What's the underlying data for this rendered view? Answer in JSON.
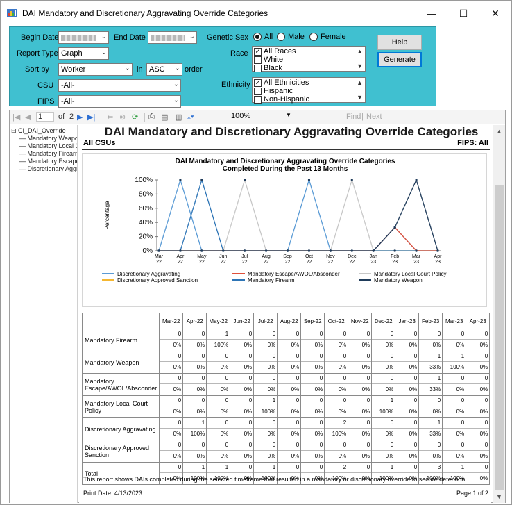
{
  "window": {
    "title": "DAI Mandatory and Discretionary Aggravating Override Categories",
    "minimize_glyph": "—",
    "maximize_glyph": "☐",
    "close_glyph": "✕"
  },
  "filters": {
    "begin_date_label": "Begin Date",
    "end_date_label": "End Date",
    "report_type_label": "Report Type",
    "report_type_value": "Graph",
    "sort_by_label": "Sort by",
    "sort_by_value": "Worker",
    "in_label": "in",
    "order_value": "ASC",
    "order_label": "order",
    "csu_label": "CSU",
    "csu_value": "-All-",
    "fips_label": "FIPS",
    "fips_value": "-All-",
    "genetic_sex_label": "Genetic Sex",
    "sex_options": [
      {
        "label": "All",
        "selected": true
      },
      {
        "label": "Male",
        "selected": false
      },
      {
        "label": "Female",
        "selected": false
      }
    ],
    "race_label": "Race",
    "race_items": [
      {
        "label": "All Races",
        "checked": true
      },
      {
        "label": "White",
        "checked": false
      },
      {
        "label": "Black",
        "checked": false
      }
    ],
    "ethnicity_label": "Ethnicity",
    "ethnicity_items": [
      {
        "label": "All Ethnicities",
        "checked": true
      },
      {
        "label": "Hispanic",
        "checked": false
      },
      {
        "label": "Non-Hispanic",
        "checked": false
      }
    ],
    "help_label": "Help",
    "generate_label": "Generate",
    "panel_color": "#40c0d0"
  },
  "toolbar": {
    "current_page": "1",
    "of_label": "of",
    "total_pages": "2",
    "zoom": "100%",
    "find_label": "Find",
    "next_label": "Next",
    "separator": "|"
  },
  "doc_map": {
    "root": "CI_DAI_Override",
    "items": [
      "Mandatory Weapon",
      "Mandatory Local Court Policy",
      "Mandatory Firearm",
      "Mandatory Escape/AWOL/Absconder",
      "Discretionary Aggravating"
    ]
  },
  "report": {
    "title": "DAI Mandatory and Discretionary Aggravating Override Categories",
    "csu": "All CSUs",
    "fips": "FIPS: All",
    "footnote": "This report shows DAIs completed during the selected timeframe that resulted in a mandatory or discretionary override to secure detention.",
    "print_date": "Print Date: 4/13/2023",
    "page": "Page 1 of 2"
  },
  "chart_data": {
    "type": "line",
    "title": "DAI Mandatory and Discretionary Aggravating Override Categories",
    "subtitle": "Completed During the Past 13 Months",
    "ylabel": "Percentage",
    "xlabel": "",
    "ylim": [
      0,
      100
    ],
    "yticks": [
      "0%",
      "20%",
      "40%",
      "60%",
      "80%",
      "100%"
    ],
    "categories": [
      "Mar 22",
      "Apr 22",
      "May 22",
      "Jun 22",
      "Jul 22",
      "Aug 22",
      "Sep 22",
      "Oct 22",
      "Nov 22",
      "Dec 22",
      "Jan 23",
      "Feb 23",
      "Mar 23",
      "Apr 23"
    ],
    "legend_position": "bottom",
    "grid": false,
    "series": [
      {
        "name": "Discretionary Aggravating",
        "color": "#5b9bd5",
        "values": [
          0,
          100,
          0,
          0,
          0,
          0,
          0,
          100,
          0,
          0,
          0,
          33,
          0,
          0
        ]
      },
      {
        "name": "Mandatory Escape/AWOL/Absconder",
        "color": "#e0503a",
        "values": [
          0,
          0,
          0,
          0,
          0,
          0,
          0,
          0,
          0,
          0,
          0,
          33,
          0,
          0
        ]
      },
      {
        "name": "Mandatory Local Court Policy",
        "color": "#c8c8c8",
        "values": [
          0,
          0,
          0,
          0,
          100,
          0,
          0,
          0,
          0,
          100,
          0,
          0,
          0,
          0
        ]
      },
      {
        "name": "Discretionary Approved Sanction",
        "color": "#f5b731",
        "values": [
          0,
          0,
          0,
          0,
          0,
          0,
          0,
          0,
          0,
          0,
          0,
          0,
          0,
          0
        ]
      },
      {
        "name": "Mandatory Firearm",
        "color": "#2e75b6",
        "values": [
          0,
          0,
          100,
          0,
          0,
          0,
          0,
          0,
          0,
          0,
          0,
          0,
          0,
          0
        ]
      },
      {
        "name": "Mandatory Weapon",
        "color": "#1f3b5a",
        "values": [
          0,
          0,
          0,
          0,
          0,
          0,
          0,
          0,
          0,
          0,
          0,
          33,
          100,
          0
        ]
      }
    ]
  },
  "table": {
    "columns": [
      "Mar-22",
      "Apr-22",
      "May-22",
      "Jun-22",
      "Jul-22",
      "Aug-22",
      "Sep-22",
      "Oct-22",
      "Nov-22",
      "Dec-22",
      "Jan-23",
      "Feb-23",
      "Mar-23",
      "Apr-23"
    ],
    "rows": [
      {
        "label": "Mandatory Firearm",
        "counts": [
          "0",
          "0",
          "1",
          "0",
          "0",
          "0",
          "0",
          "0",
          "0",
          "0",
          "0",
          "0",
          "0",
          "0"
        ],
        "pcts": [
          "0%",
          "0%",
          "100%",
          "0%",
          "0%",
          "0%",
          "0%",
          "0%",
          "0%",
          "0%",
          "0%",
          "0%",
          "0%",
          "0%"
        ]
      },
      {
        "label": "Mandatory Weapon",
        "counts": [
          "0",
          "0",
          "0",
          "0",
          "0",
          "0",
          "0",
          "0",
          "0",
          "0",
          "0",
          "1",
          "1",
          "0"
        ],
        "pcts": [
          "0%",
          "0%",
          "0%",
          "0%",
          "0%",
          "0%",
          "0%",
          "0%",
          "0%",
          "0%",
          "0%",
          "33%",
          "100%",
          "0%"
        ]
      },
      {
        "label": "Mandatory Escape/AWOL/Absconder",
        "counts": [
          "0",
          "0",
          "0",
          "0",
          "0",
          "0",
          "0",
          "0",
          "0",
          "0",
          "0",
          "1",
          "0",
          "0"
        ],
        "pcts": [
          "0%",
          "0%",
          "0%",
          "0%",
          "0%",
          "0%",
          "0%",
          "0%",
          "0%",
          "0%",
          "0%",
          "33%",
          "0%",
          "0%"
        ]
      },
      {
        "label": "Mandatory Local Court Policy",
        "counts": [
          "0",
          "0",
          "0",
          "0",
          "1",
          "0",
          "0",
          "0",
          "0",
          "1",
          "0",
          "0",
          "0",
          "0"
        ],
        "pcts": [
          "0%",
          "0%",
          "0%",
          "0%",
          "100%",
          "0%",
          "0%",
          "0%",
          "0%",
          "100%",
          "0%",
          "0%",
          "0%",
          "0%"
        ]
      },
      {
        "label": "Discretionary Aggravating",
        "counts": [
          "0",
          "1",
          "0",
          "0",
          "0",
          "0",
          "0",
          "2",
          "0",
          "0",
          "0",
          "1",
          "0",
          "0"
        ],
        "pcts": [
          "0%",
          "100%",
          "0%",
          "0%",
          "0%",
          "0%",
          "0%",
          "100%",
          "0%",
          "0%",
          "0%",
          "33%",
          "0%",
          "0%"
        ]
      },
      {
        "label": "Discretionary Approved Sanction",
        "counts": [
          "0",
          "0",
          "0",
          "0",
          "0",
          "0",
          "0",
          "0",
          "0",
          "0",
          "0",
          "0",
          "0",
          "0"
        ],
        "pcts": [
          "0%",
          "0%",
          "0%",
          "0%",
          "0%",
          "0%",
          "0%",
          "0%",
          "0%",
          "0%",
          "0%",
          "0%",
          "0%",
          "0%"
        ]
      },
      {
        "label": "Total",
        "counts": [
          "0",
          "1",
          "1",
          "0",
          "1",
          "0",
          "0",
          "2",
          "0",
          "1",
          "0",
          "3",
          "1",
          "0"
        ],
        "pcts": [
          "0%",
          "100%",
          "100%",
          "0%",
          "100%",
          "0%",
          "0%",
          "100%",
          "0%",
          "100%",
          "0%",
          "100%",
          "100%",
          "0%"
        ]
      }
    ]
  }
}
